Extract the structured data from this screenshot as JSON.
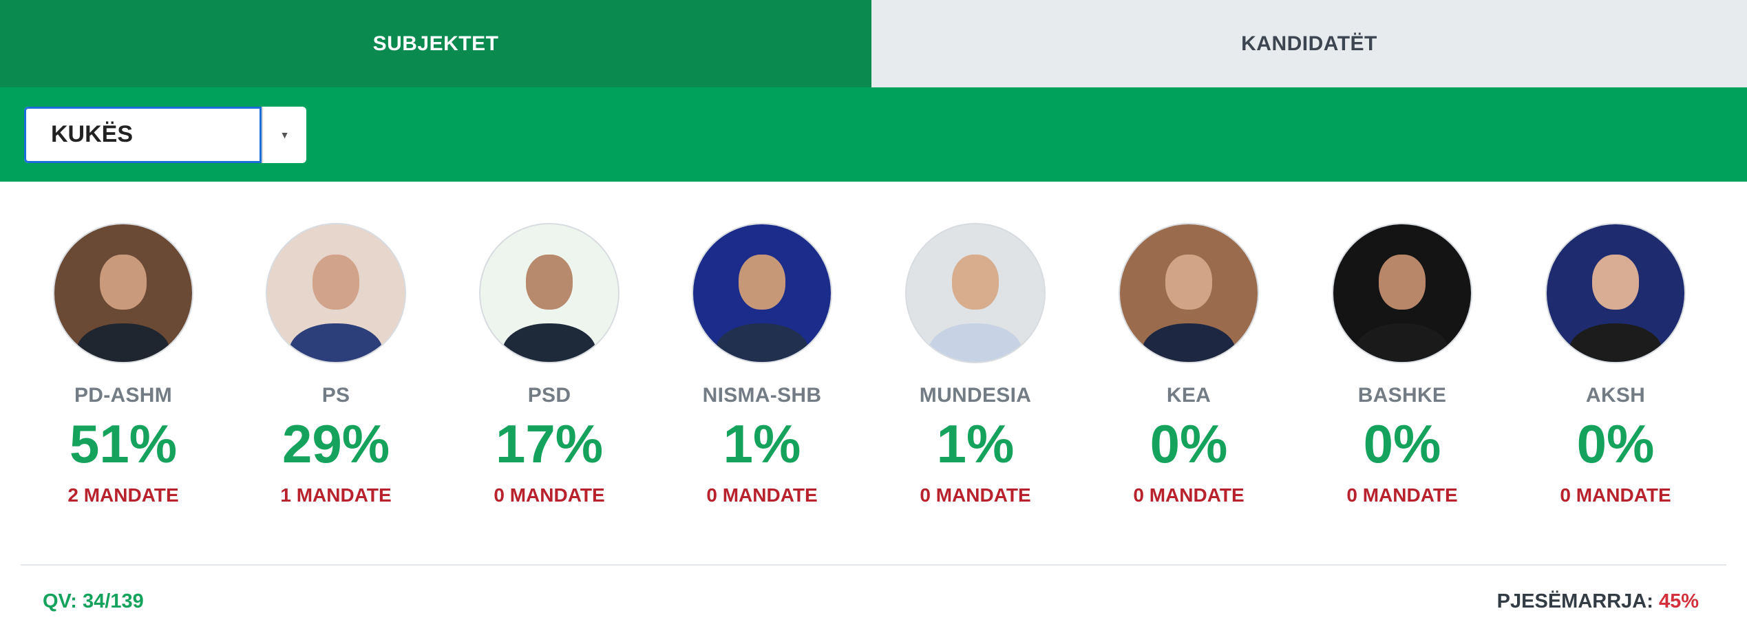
{
  "tabs": {
    "subjects": "SUBJEKTET",
    "candidates": "KANDIDATËT"
  },
  "filter": {
    "selected": "KUKËS",
    "arrow_icon": "caret-down-icon"
  },
  "parties": [
    {
      "name": "PD-ASHM",
      "percent": "51%",
      "seats": "2 MANDATE"
    },
    {
      "name": "PS",
      "percent": "29%",
      "seats": "1 MANDATE"
    },
    {
      "name": "PSD",
      "percent": "17%",
      "seats": "0 MANDATE"
    },
    {
      "name": "NISMA-SHB",
      "percent": "1%",
      "seats": "0 MANDATE"
    },
    {
      "name": "MUNDESIA",
      "percent": "1%",
      "seats": "0 MANDATE"
    },
    {
      "name": "KEA",
      "percent": "0%",
      "seats": "0 MANDATE"
    },
    {
      "name": "BASHKE",
      "percent": "0%",
      "seats": "0 MANDATE"
    },
    {
      "name": "AKSH",
      "percent": "0%",
      "seats": "0 MANDATE"
    }
  ],
  "footer": {
    "stations": "QV: 34/139",
    "turnout_label": "PJESËMARRJA:",
    "turnout_value": "45%"
  },
  "colors": {
    "tab_active": "#0a8a4e",
    "tab_inactive": "#e8ebee",
    "filter_bar": "#00a25b",
    "percent_green": "#14a25c",
    "seats_red": "#b8222d"
  }
}
